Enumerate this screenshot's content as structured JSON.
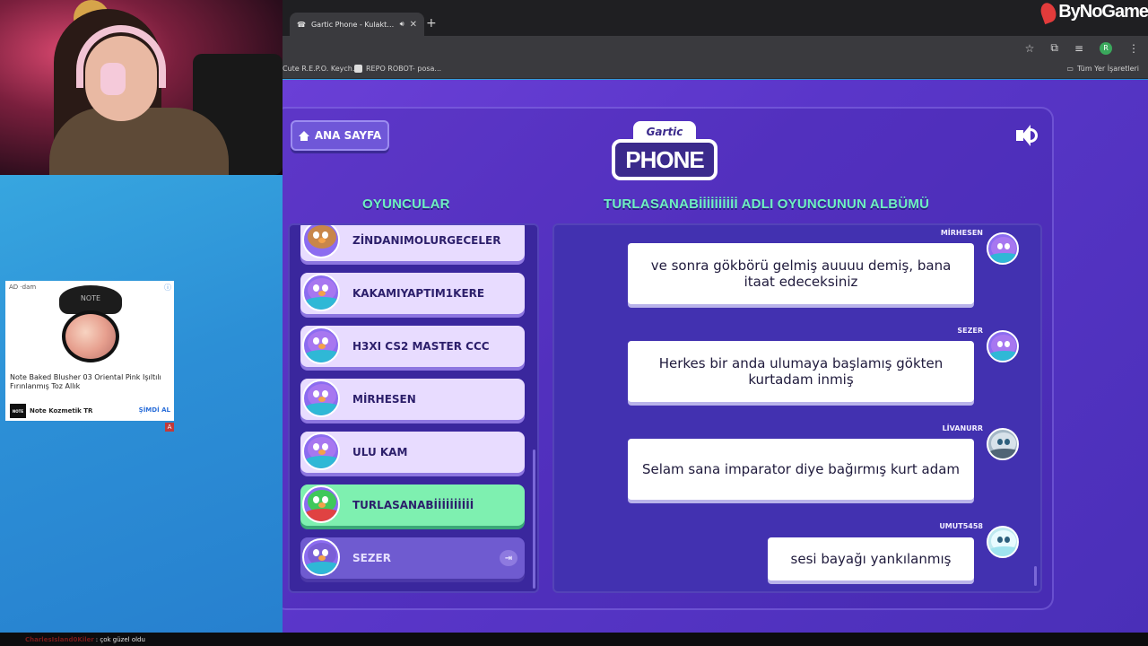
{
  "browser": {
    "tab_title": "Gartic Phone - Kulaktan Kul...",
    "bookmarks": [
      "Cute R.E.P.O. Keych...",
      "REPO ROBOT- posa..."
    ],
    "bookmarks_right": "Tüm Yer İşaretleri",
    "profile_initial": "R"
  },
  "watermark": "ByNoGame",
  "ad": {
    "label": "AD",
    "label_suffix": "dam",
    "compact_text": "NOTE",
    "title": "Note Baked Blusher 03 Oriental Pink Işıltılı Fırınlanmış Toz Allık",
    "brand_box": "NOTE",
    "brand": "Note Kozmetik TR",
    "cta": "ŞİMDİ AL",
    "badge": "A"
  },
  "game": {
    "home_label": "ANA SAYFA",
    "logo_top": "Gartic",
    "logo_main": "PHONE",
    "players_title": "OYUNCULAR",
    "album_title": "TURLASANABİİİİİİİİİİ ADLI OYUNCUNUN ALBÜMÜ",
    "players": [
      {
        "name": "ZİNDANIMOLURGECELER",
        "avatar": "bear"
      },
      {
        "name": "KAKAMIYAPTIM1KERE",
        "avatar": "bird"
      },
      {
        "name": "H3XI CS2 MASTER CCC",
        "avatar": "bird"
      },
      {
        "name": "MİRHESEN",
        "avatar": "bird"
      },
      {
        "name": "ULU KAM",
        "avatar": "bird"
      },
      {
        "name": "TURLASANABİİİİİİİİİİ",
        "avatar": "green"
      },
      {
        "name": "SEZER",
        "avatar": "dim"
      }
    ],
    "album": [
      {
        "author": "MİRHESEN",
        "text": "ve sonra gökbörü gelmiş auuuu demiş, bana itaat edeceksiniz"
      },
      {
        "author": "SEZER",
        "text": "Herkes bir anda ulumaya başlamış gökten kurtadam inmiş"
      },
      {
        "author": "LİVANURR",
        "text": "Selam sana imparator diye bağırmış kurt adam"
      },
      {
        "author": "UMUT5458",
        "text": "sesi bayağı yankılanmış"
      }
    ]
  },
  "chat": {
    "user": "CharlesIsland0Kiler",
    "message": ": çok güzel oldu"
  }
}
